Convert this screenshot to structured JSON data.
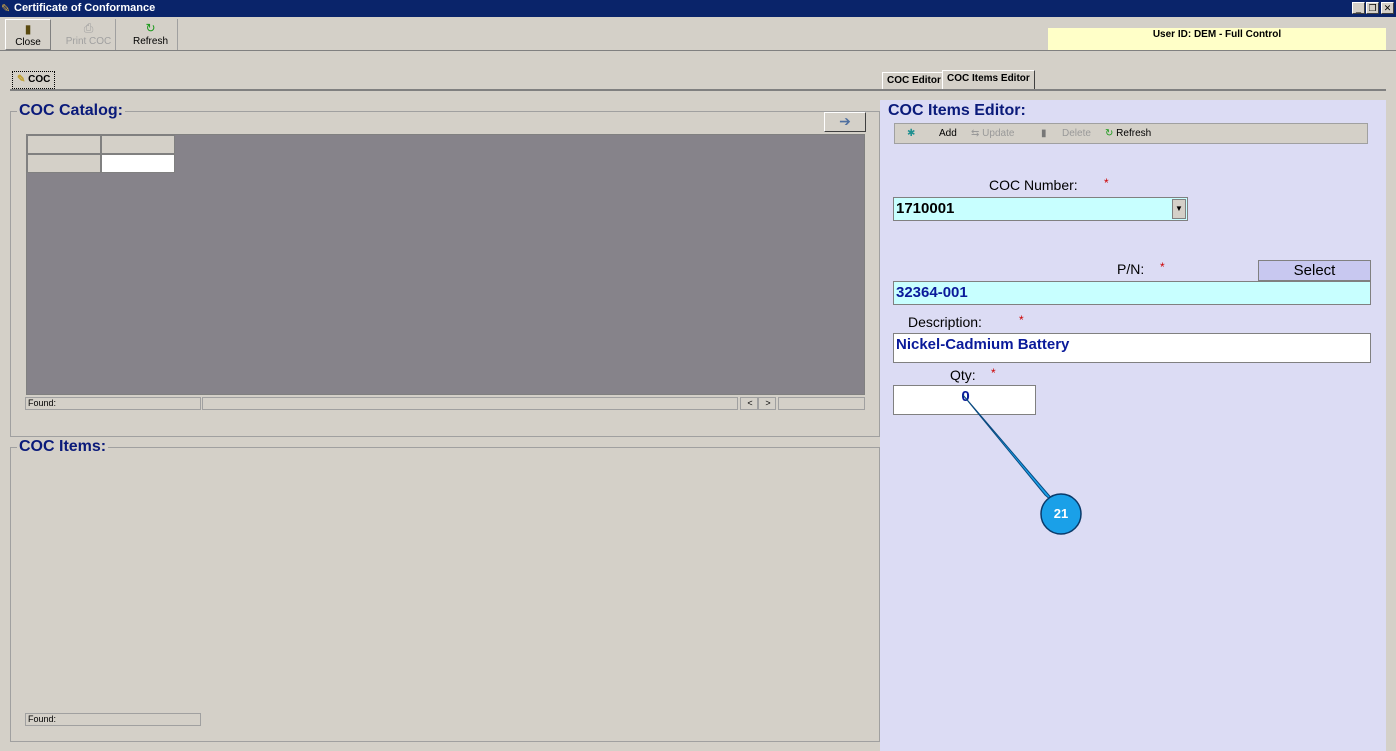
{
  "window": {
    "title": "Certificate of Conformance"
  },
  "toolbar": {
    "close": "Close",
    "print": "Print COC",
    "refresh": "Refresh"
  },
  "user": "User ID: DEM - Full Control",
  "left_tab": "COC",
  "right_tabs": [
    "COC Editor",
    "COC Items Editor"
  ],
  "catalog": {
    "title": "COC Catalog:",
    "found": "Found:"
  },
  "items": {
    "title": "COC Items:",
    "found": "Found:"
  },
  "editor": {
    "title": "COC Items Editor:",
    "toolbar": {
      "add": "Add",
      "update": "Update",
      "delete": "Delete",
      "refresh": "Refresh"
    },
    "coc_number_label": "COC Number:",
    "coc_number": "1710001",
    "pn_label": "P/N:",
    "pn": "32364-001",
    "select": "Select",
    "desc_label": "Description:",
    "desc": "Nickel-Cadmium Battery",
    "qty_label": "Qty:",
    "qty": "0",
    "required": "*"
  },
  "callout": "21"
}
